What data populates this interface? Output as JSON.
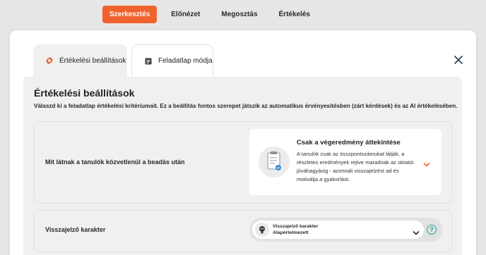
{
  "nav": {
    "items": [
      {
        "label": "Szerkesztés",
        "active": true
      },
      {
        "label": "Előnézet",
        "active": false
      },
      {
        "label": "Megosztás",
        "active": false
      },
      {
        "label": "Értékelés",
        "active": false
      }
    ]
  },
  "tabs": {
    "evaluation_settings": {
      "label": "Értékelési beállítások",
      "icon": "gear-icon"
    },
    "worksheet_mode": {
      "label": "Feladatlap módja",
      "icon": "document-icon"
    }
  },
  "panel": {
    "title": "Értékelési beállítások",
    "description": "Válaszd ki a feladatlap értékelési kritériumait. Ez a beállítás fontos szerepet játszik az automatikus érvényesítésben (zárt kérdések) és az AI értékelésében."
  },
  "after_submit": {
    "label": "Mit látnak a tanulók közvetlenül a beadás után",
    "option_title": "Csak a végeredmény áttekintése",
    "option_text": "A tanulók csak az összpontszámukat látják, a részletes eredmények rejtve maradnak az oktatói jóváhagyásig - azonnali visszajelzést ad és motiválja a gyakorlást."
  },
  "feedback_character": {
    "label": "Visszajelző karakter",
    "select_title": "Visszajelző karakter",
    "select_value": "Alapértelmezett",
    "help_symbol": "?"
  },
  "colors": {
    "accent": "#f0622d",
    "help": "#2aa199",
    "badge": "#3b8fd6"
  }
}
